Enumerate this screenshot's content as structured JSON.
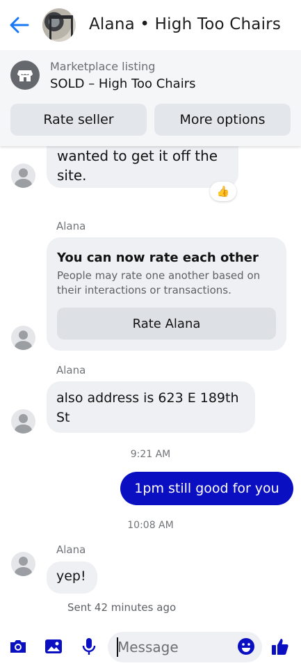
{
  "header": {
    "title": "Alana • High Too Chairs"
  },
  "listing": {
    "subtitle": "Marketplace listing",
    "title": "SOLD – High Too Chairs",
    "rate_seller_label": "Rate seller",
    "more_options_label": "More options"
  },
  "messages": {
    "first_bubble": "wanted to get it off the site.",
    "sender_1": "Alana",
    "rating_card": {
      "title": "You can now rate each other",
      "body": "People may rate one another based on their interactions or transactions.",
      "button_label": "Rate Alana"
    },
    "sender_2": "Alana",
    "address_bubble": "also address is 623 E 189th St",
    "time_1": "9:21 AM",
    "outgoing_bubble": "1pm still good for you",
    "time_2": "10:08 AM",
    "sender_3": "Alana",
    "yep_bubble": "yep!",
    "sent_status": "Sent 42 minutes ago"
  },
  "composer": {
    "placeholder": "Message"
  },
  "colors": {
    "accent_blue": "#1877f2",
    "outgoing_bubble": "#0a0fc2",
    "incoming_bubble": "#eff0f3"
  },
  "icons": {
    "back": "arrow-left-icon",
    "store": "store-icon",
    "reaction": "thumbs-up-icon",
    "camera": "camera-icon",
    "gallery": "image-icon",
    "mic": "microphone-icon",
    "emoji": "emoji-icon",
    "like": "thumbs-up-icon"
  }
}
